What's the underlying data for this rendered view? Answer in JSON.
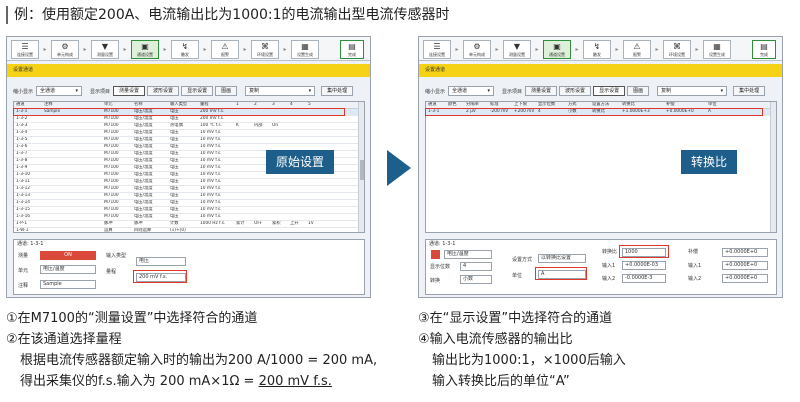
{
  "heading": "例：使用额定200A、电流输出比为1000:1的电流输出型电流传感器时",
  "toolbar": {
    "buttons": [
      {
        "icon": "☰",
        "label": "连接设置"
      },
      {
        "icon": "⚙",
        "label": "单元构成"
      },
      {
        "icon": "▼",
        "label": "测量设置"
      },
      {
        "icon": "▣",
        "label": "通道设置"
      },
      {
        "icon": "↯",
        "label": "触发"
      },
      {
        "icon": "⚠",
        "label": "报警"
      },
      {
        "icon": "⌘",
        "label": "环境设置"
      },
      {
        "icon": "▦",
        "label": "设置生成"
      }
    ],
    "close_label": "完成"
  },
  "left": {
    "section_title": "设置通道",
    "display_label": "缩小显示",
    "display_value": "全通道",
    "items_label": "显示项目",
    "tabs": [
      "测量设置",
      "波形设置",
      "显示设置",
      "图画"
    ],
    "copy_label": "复制",
    "batch_label": "集中处理",
    "columns": [
      "通道",
      "注释",
      "单元",
      "名称",
      "输入类型",
      "量程",
      "1",
      "2",
      "3",
      "4",
      "5"
    ],
    "rows": [
      [
        "1-3-1",
        "Sample",
        "M7100",
        "电压/温度",
        "电压",
        "200 mV f.s.",
        "",
        "",
        "",
        "",
        ""
      ],
      [
        "1-3-2",
        "",
        "M7100",
        "电压/温度",
        "电压",
        "200 mV f.s.",
        "",
        "",
        "",
        "",
        ""
      ],
      [
        "1-3-3",
        "",
        "M7100",
        "电压/温度",
        "热电偶",
        "100 ℃ f.s.",
        "K",
        "内部",
        "On",
        "",
        ""
      ],
      [
        "1-3-4",
        "",
        "M7100",
        "电压/温度",
        "电压",
        "10 mV f.s.",
        "",
        "",
        "",
        "",
        ""
      ],
      [
        "1-3-5",
        "",
        "M7100",
        "电压/温度",
        "电压",
        "10 mV f.s.",
        "",
        "",
        "",
        "",
        ""
      ],
      [
        "1-3-6",
        "",
        "M7100",
        "电压/温度",
        "电压",
        "10 mV f.s.",
        "",
        "",
        "",
        "",
        ""
      ],
      [
        "1-3-7",
        "",
        "M7100",
        "电压/温度",
        "电压",
        "10 mV f.s.",
        "",
        "",
        "",
        "",
        ""
      ],
      [
        "1-3-8",
        "",
        "M7100",
        "电压/温度",
        "电压",
        "10 mV f.s.",
        "",
        "",
        "",
        "",
        ""
      ],
      [
        "1-3-9",
        "",
        "M7100",
        "电压/温度",
        "电压",
        "10 mV f.s.",
        "",
        "",
        "",
        "",
        ""
      ],
      [
        "1-3-10",
        "",
        "M7100",
        "电压/温度",
        "电压",
        "10 mV f.s.",
        "",
        "",
        "",
        "",
        ""
      ],
      [
        "1-3-11",
        "",
        "M7100",
        "电压/温度",
        "电压",
        "10 mV f.s.",
        "",
        "",
        "",
        "",
        ""
      ],
      [
        "1-3-12",
        "",
        "M7100",
        "电压/温度",
        "电压",
        "10 mV f.s.",
        "",
        "",
        "",
        "",
        ""
      ],
      [
        "1-3-13",
        "",
        "M7100",
        "电压/温度",
        "电压",
        "10 mV f.s.",
        "",
        "",
        "",
        "",
        ""
      ],
      [
        "1-3-14",
        "",
        "M7100",
        "电压/温度",
        "电压",
        "10 mV f.s.",
        "",
        "",
        "",
        "",
        ""
      ],
      [
        "1-3-15",
        "",
        "M7100",
        "电压/温度",
        "电压",
        "10 mV f.s.",
        "",
        "",
        "",
        "",
        ""
      ],
      [
        "1-3-16",
        "",
        "M7100",
        "电压/温度",
        "电压",
        "10 mV f.s.",
        "",
        "",
        "",
        "",
        ""
      ],
      [
        "1-P-1",
        "",
        "脉冲",
        "脉冲",
        "计数",
        "1000 Hz f.s.",
        "累计",
        "OFF",
        "累积",
        "上升",
        "1V"
      ],
      [
        "1-W-1",
        "",
        "运算",
        "四则运算",
        "(1)+(0)",
        "",
        "",
        "",
        "",
        "",
        ""
      ],
      [
        "1-W-2",
        "",
        "运算",
        "四则运算",
        "(1)+(0)",
        "",
        "",
        "",
        "",
        "",
        ""
      ]
    ],
    "overlay_label": "原始设置",
    "panel_title": "通道: 1-3-1",
    "measure_label": "测量",
    "measure_value": "ON",
    "unit_label": "单元",
    "unit_value": "电压/温度",
    "note_label": "注释",
    "note_value": "Sample",
    "input_type_label": "输入类型",
    "input_type_value": "电压",
    "range_label": "量程",
    "range_value": "200 mV f.s."
  },
  "right": {
    "section_title": "设置通道",
    "display_label": "缩小显示",
    "display_value": "全通道",
    "items_label": "显示项目",
    "tabs": [
      "测量设置",
      "波形设置",
      "显示设置",
      "图画"
    ],
    "copy_label": "复制",
    "batch_label": "集中处理",
    "columns": [
      "通道",
      "颜色",
      "分隔率",
      "标准",
      "上下限",
      "显示位数",
      "方式",
      "设置方法",
      "转换比",
      "补偿",
      "单位"
    ],
    "rows": [
      [
        "1-3-1",
        "",
        "2 µV",
        "-200 mV",
        "+200 mV",
        "4",
        "小数",
        "转换比",
        "+1.0000E+3",
        "+0.0000E+0",
        "A"
      ]
    ],
    "overlay_label": "转换比",
    "panel_title": "通道: 1-3-1",
    "unit_name_value": "电压/温度",
    "digits_label": "显示位数",
    "digits_value": "4",
    "convert_label": "转换",
    "convert_value": "小数",
    "method_label": "设置方式",
    "method_value": "以转换比设置",
    "unit_label": "单位",
    "unit_value": "A",
    "ratio_label": "转换比",
    "ratio_value": "1000",
    "offset_label": "补偿",
    "offset_value": "+0.0000E+0",
    "in1_label": "输入1",
    "in1_value": "+0.0000E-03",
    "in2_label": "输入2",
    "in2_value": "-0.0000E-3",
    "out1_label": "输入1",
    "out1_value": "+0.0000E+0",
    "out2_label": "输入2",
    "out2_value": "+0.0000E+0"
  },
  "captions_left": {
    "line1": "①在M7100的“测量设置”中选择符合的通道",
    "line2": "②在该通道选择量程",
    "line3": "根据电流传感器额定输入时的输出为200 A/1000 = 200 mA,",
    "line4a": "得出采集仪的f.s.输入为 200 mA×1Ω = ",
    "line4b": "200 mV f.s."
  },
  "captions_right": {
    "line1": "③在“显示设置”中选择符合的通道",
    "line2": "④输入电流传感器的输出比",
    "line3": "输出比为1000:1，×1000后输入",
    "line4": "输入转换比后的单位“A”"
  },
  "colors": {
    "accent_yellow": "#f5d216",
    "highlight_red": "#e0372b",
    "overlay_blue": "#1e5e8a",
    "button_red": "#d94a3a",
    "active_green": "#2d8f3a"
  }
}
